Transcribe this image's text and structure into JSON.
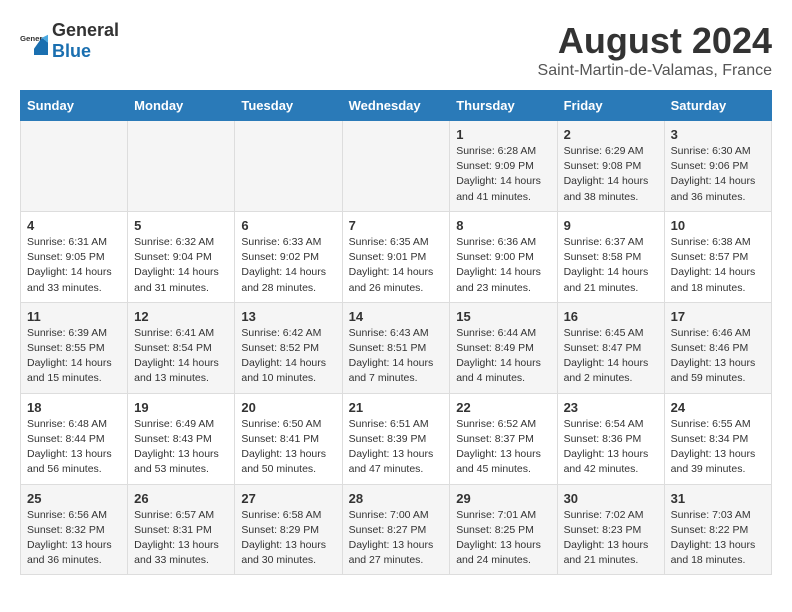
{
  "logo": {
    "general": "General",
    "blue": "Blue"
  },
  "title": "August 2024",
  "subtitle": "Saint-Martin-de-Valamas, France",
  "days_header": [
    "Sunday",
    "Monday",
    "Tuesday",
    "Wednesday",
    "Thursday",
    "Friday",
    "Saturday"
  ],
  "weeks": [
    [
      {
        "day": "",
        "info": ""
      },
      {
        "day": "",
        "info": ""
      },
      {
        "day": "",
        "info": ""
      },
      {
        "day": "",
        "info": ""
      },
      {
        "day": "1",
        "info": "Sunrise: 6:28 AM\nSunset: 9:09 PM\nDaylight: 14 hours\nand 41 minutes."
      },
      {
        "day": "2",
        "info": "Sunrise: 6:29 AM\nSunset: 9:08 PM\nDaylight: 14 hours\nand 38 minutes."
      },
      {
        "day": "3",
        "info": "Sunrise: 6:30 AM\nSunset: 9:06 PM\nDaylight: 14 hours\nand 36 minutes."
      }
    ],
    [
      {
        "day": "4",
        "info": "Sunrise: 6:31 AM\nSunset: 9:05 PM\nDaylight: 14 hours\nand 33 minutes."
      },
      {
        "day": "5",
        "info": "Sunrise: 6:32 AM\nSunset: 9:04 PM\nDaylight: 14 hours\nand 31 minutes."
      },
      {
        "day": "6",
        "info": "Sunrise: 6:33 AM\nSunset: 9:02 PM\nDaylight: 14 hours\nand 28 minutes."
      },
      {
        "day": "7",
        "info": "Sunrise: 6:35 AM\nSunset: 9:01 PM\nDaylight: 14 hours\nand 26 minutes."
      },
      {
        "day": "8",
        "info": "Sunrise: 6:36 AM\nSunset: 9:00 PM\nDaylight: 14 hours\nand 23 minutes."
      },
      {
        "day": "9",
        "info": "Sunrise: 6:37 AM\nSunset: 8:58 PM\nDaylight: 14 hours\nand 21 minutes."
      },
      {
        "day": "10",
        "info": "Sunrise: 6:38 AM\nSunset: 8:57 PM\nDaylight: 14 hours\nand 18 minutes."
      }
    ],
    [
      {
        "day": "11",
        "info": "Sunrise: 6:39 AM\nSunset: 8:55 PM\nDaylight: 14 hours\nand 15 minutes."
      },
      {
        "day": "12",
        "info": "Sunrise: 6:41 AM\nSunset: 8:54 PM\nDaylight: 14 hours\nand 13 minutes."
      },
      {
        "day": "13",
        "info": "Sunrise: 6:42 AM\nSunset: 8:52 PM\nDaylight: 14 hours\nand 10 minutes."
      },
      {
        "day": "14",
        "info": "Sunrise: 6:43 AM\nSunset: 8:51 PM\nDaylight: 14 hours\nand 7 minutes."
      },
      {
        "day": "15",
        "info": "Sunrise: 6:44 AM\nSunset: 8:49 PM\nDaylight: 14 hours\nand 4 minutes."
      },
      {
        "day": "16",
        "info": "Sunrise: 6:45 AM\nSunset: 8:47 PM\nDaylight: 14 hours\nand 2 minutes."
      },
      {
        "day": "17",
        "info": "Sunrise: 6:46 AM\nSunset: 8:46 PM\nDaylight: 13 hours\nand 59 minutes."
      }
    ],
    [
      {
        "day": "18",
        "info": "Sunrise: 6:48 AM\nSunset: 8:44 PM\nDaylight: 13 hours\nand 56 minutes."
      },
      {
        "day": "19",
        "info": "Sunrise: 6:49 AM\nSunset: 8:43 PM\nDaylight: 13 hours\nand 53 minutes."
      },
      {
        "day": "20",
        "info": "Sunrise: 6:50 AM\nSunset: 8:41 PM\nDaylight: 13 hours\nand 50 minutes."
      },
      {
        "day": "21",
        "info": "Sunrise: 6:51 AM\nSunset: 8:39 PM\nDaylight: 13 hours\nand 47 minutes."
      },
      {
        "day": "22",
        "info": "Sunrise: 6:52 AM\nSunset: 8:37 PM\nDaylight: 13 hours\nand 45 minutes."
      },
      {
        "day": "23",
        "info": "Sunrise: 6:54 AM\nSunset: 8:36 PM\nDaylight: 13 hours\nand 42 minutes."
      },
      {
        "day": "24",
        "info": "Sunrise: 6:55 AM\nSunset: 8:34 PM\nDaylight: 13 hours\nand 39 minutes."
      }
    ],
    [
      {
        "day": "25",
        "info": "Sunrise: 6:56 AM\nSunset: 8:32 PM\nDaylight: 13 hours\nand 36 minutes."
      },
      {
        "day": "26",
        "info": "Sunrise: 6:57 AM\nSunset: 8:31 PM\nDaylight: 13 hours\nand 33 minutes."
      },
      {
        "day": "27",
        "info": "Sunrise: 6:58 AM\nSunset: 8:29 PM\nDaylight: 13 hours\nand 30 minutes."
      },
      {
        "day": "28",
        "info": "Sunrise: 7:00 AM\nSunset: 8:27 PM\nDaylight: 13 hours\nand 27 minutes."
      },
      {
        "day": "29",
        "info": "Sunrise: 7:01 AM\nSunset: 8:25 PM\nDaylight: 13 hours\nand 24 minutes."
      },
      {
        "day": "30",
        "info": "Sunrise: 7:02 AM\nSunset: 8:23 PM\nDaylight: 13 hours\nand 21 minutes."
      },
      {
        "day": "31",
        "info": "Sunrise: 7:03 AM\nSunset: 8:22 PM\nDaylight: 13 hours\nand 18 minutes."
      }
    ]
  ]
}
